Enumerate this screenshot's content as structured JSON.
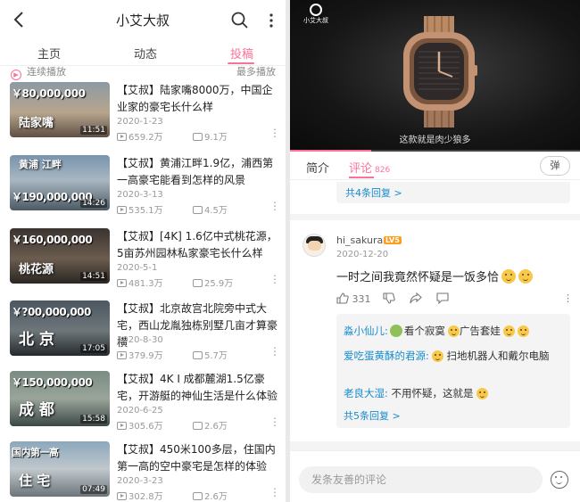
{
  "left": {
    "header": {
      "title": "小艾大叔"
    },
    "tabs": [
      {
        "label": "主页",
        "active": false
      },
      {
        "label": "动态",
        "active": false
      },
      {
        "label": "投稿",
        "active": true
      }
    ],
    "continuous_play": "连续播放",
    "sort_label": "最多播放",
    "videos": [
      {
        "title": "【艾叔】陆家嘴8000万，中国企业家的豪宅长什么样",
        "date": "2020-1-23",
        "plays": "659.2万",
        "danmaku": "9.1万",
        "duration": "11:51",
        "thumb_price": "￥80,000,000",
        "thumb_place": "陆家嘴"
      },
      {
        "title": "【艾叔】黄浦江畔1.9亿，浦西第一高豪宅能看到怎样的风景",
        "date": "2020-3-13",
        "plays": "535.1万",
        "danmaku": "4.5万",
        "duration": "14:26",
        "thumb_price": "￥190,000,000",
        "thumb_place": "黄浦 江畔"
      },
      {
        "title": "【艾叔】[4K] 1.6亿中式桃花源，5亩苏州园林私家豪宅长什么样",
        "date": "2020-5-1",
        "plays": "481.3万",
        "danmaku": "25.9万",
        "duration": "14:51",
        "thumb_price": "￥160,000,000",
        "thumb_place": "桃花源"
      },
      {
        "title": "【艾叔】北京故宫北院旁中式大宅，西山龙胤独栋别墅几亩才算豪横",
        "date": "2020-8-30",
        "plays": "379.9万",
        "danmaku": "5.7万",
        "duration": "17:05",
        "thumb_price": "￥?00,000,000",
        "thumb_place": "北 京"
      },
      {
        "title": "【艾叔】4K I 成都麓湖1.5亿豪宅，开游艇的神仙生活是什么体验",
        "date": "2020-6-25",
        "plays": "305.6万",
        "danmaku": "2.6万",
        "duration": "15:58",
        "thumb_price": "￥150,000,000",
        "thumb_place": "成 都"
      },
      {
        "title": "【艾叔】450米100多层，住国内第一高的空中豪宅是怎样的体验",
        "date": "2020-3-23",
        "plays": "302.8万",
        "danmaku": "2.6万",
        "duration": "07:49",
        "thumb_price": "国内第一高",
        "thumb_place": "住 宅"
      }
    ]
  },
  "right": {
    "video": {
      "logo_text": "小艾大叔",
      "subtitle": "这款就是肉少狼多",
      "progress": 0.28
    },
    "tabs": [
      {
        "label": "简介",
        "active": false
      },
      {
        "label": "评论",
        "count": "826",
        "active": true
      }
    ],
    "danmaku_toggle": "弹",
    "prev_reply_link": "共4条回复 >",
    "comment": {
      "user": "hi_sakura",
      "level": "LV5",
      "date": "2020-12-20",
      "text": "一时之间我竟然怀疑是一饭多恰",
      "likes": "331"
    },
    "replies": [
      {
        "user": "淼小仙儿:",
        "text": "看个寂寞",
        "text2": "广告套娃"
      },
      {
        "user": "爱吃蛋黄酥的君源:",
        "text": "扫地机器人和戴尔电脑"
      },
      {
        "user": "老良大湿:",
        "text": "不用怀疑，这就是"
      }
    ],
    "more_replies": "共5条回复 >",
    "input_placeholder": "发条友善的评论"
  },
  "colors": {
    "accent": "#fb7299",
    "link": "#178bcf",
    "level": "#ff9e1b"
  }
}
